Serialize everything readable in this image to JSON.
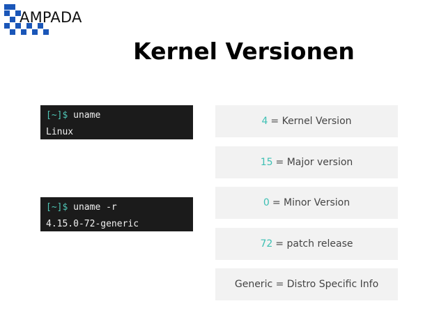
{
  "logo": {
    "text": "AMPADA"
  },
  "title": "Kernel Versionen",
  "terminals": [
    {
      "prompt": "[~]$",
      "command": " uname",
      "output": "Linux"
    },
    {
      "prompt": "[~]$",
      "command": " uname -r",
      "output": "4.15.0-72-generic"
    }
  ],
  "info_boxes": [
    {
      "number": "4",
      "label": "= Kernel Version"
    },
    {
      "number": "15",
      "label": "= Major version"
    },
    {
      "number": "0",
      "label": "= Minor Version"
    },
    {
      "number": "72",
      "label": "= patch release"
    },
    {
      "number": "",
      "label": "Generic = Distro Specific Info"
    }
  ],
  "colors": {
    "logo_blue": "#1a56b8",
    "accent_teal": "#3ec0b4",
    "terminal_bg": "#1b1b1b",
    "box_bg": "#f2f2f2"
  }
}
